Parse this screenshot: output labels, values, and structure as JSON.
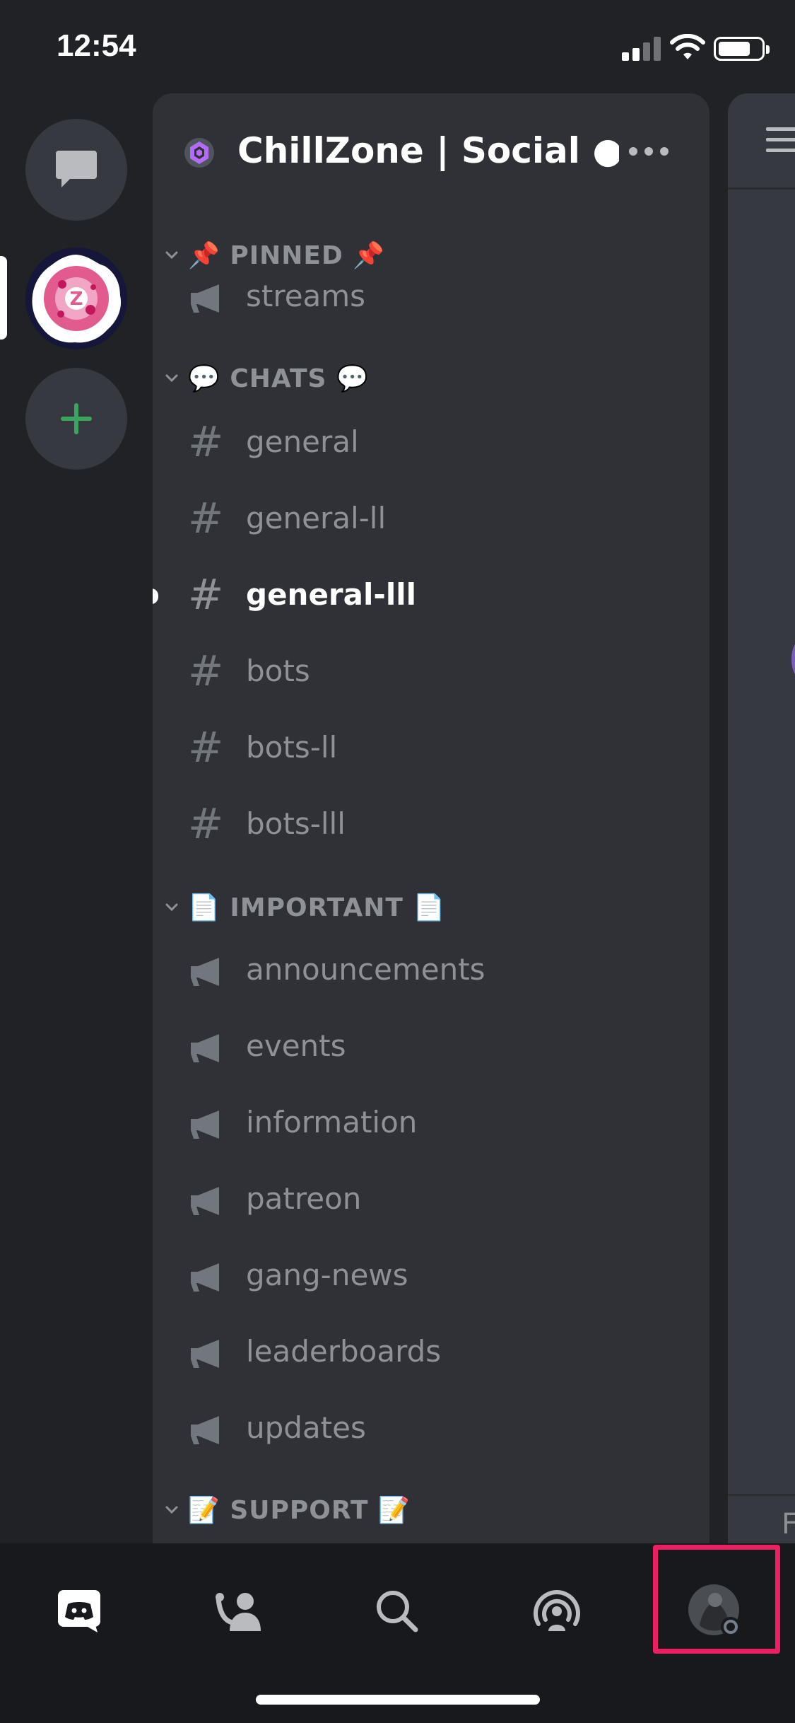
{
  "status_bar": {
    "time": "12:54"
  },
  "server": {
    "name": "ChillZone | Social ●...",
    "logo_letter": "Z"
  },
  "categories": {
    "pinned": "📌 PINNED 📌",
    "chats": "💬 CHATS 💬",
    "important": "📄 IMPORTANT 📄",
    "support": "📝 SUPPORT 📝"
  },
  "channels": {
    "streams": "streams",
    "general": "general",
    "general_ll": "general-ll",
    "general_lll": "general-lll",
    "bots": "bots",
    "bots_ll": "bots-ll",
    "bots_lll": "bots-lll",
    "announcements": "announcements",
    "events": "events",
    "information": "information",
    "patreon": "patreon",
    "gang_news": "gang-news",
    "leaderboards": "leaderboards",
    "updates": "updates"
  },
  "chat_peek": {
    "letter": "F"
  },
  "icons": {
    "hash": "#",
    "direct_messages": "chat-bubble-icon",
    "add_server": "plus-icon",
    "announcement": "megaphone-icon",
    "tab_home": "discord-logo-icon",
    "tab_friends": "friends-icon",
    "tab_search": "search-icon",
    "tab_mentions": "broadcast-icon",
    "tab_profile": "avatar"
  },
  "colors": {
    "background": "#202225",
    "panel": "#2f3136",
    "chat": "#36393f",
    "tabbar": "#18191c",
    "add_green": "#3ba55d",
    "highlight": "#ec1f63",
    "boost_purple": "#b36cf5"
  }
}
